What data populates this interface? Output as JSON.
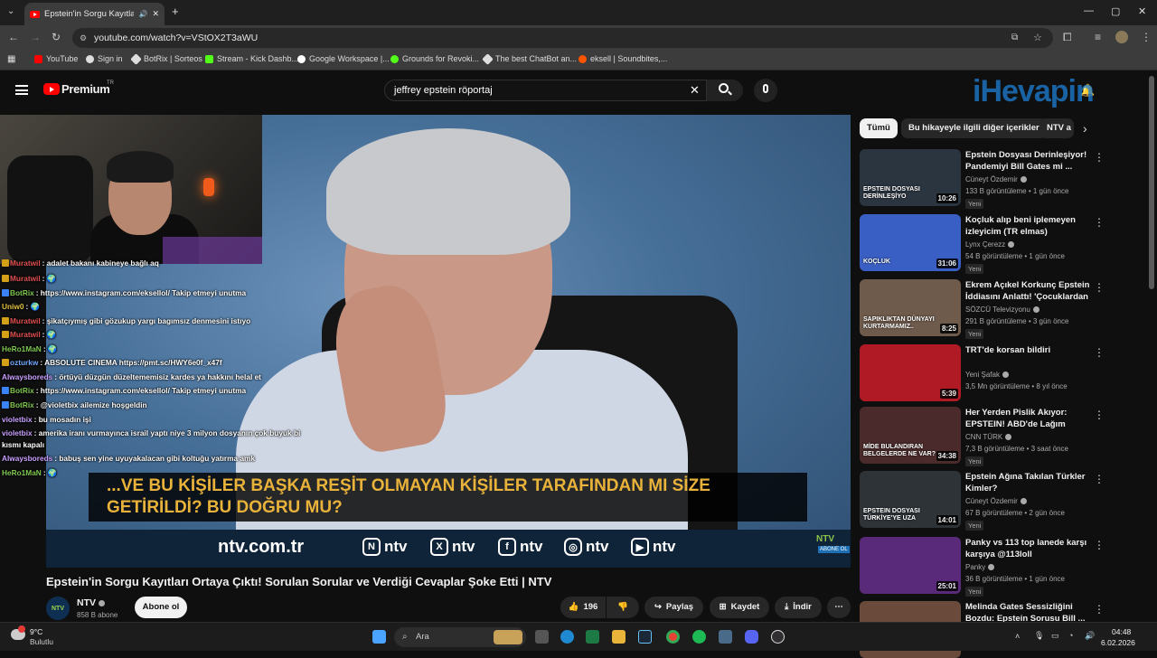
{
  "browser": {
    "tab_title": "Epstein'in Sorgu Kayıtları O",
    "url": "youtube.com/watch?v=VStOX2T3aWU",
    "bookmarks": [
      {
        "label": "YouTube",
        "color": "#ff0000"
      },
      {
        "label": "Sign in",
        "color": "#dddddd"
      },
      {
        "label": "BotRix | Sorteos",
        "color": "#dddddd"
      },
      {
        "label": "Stream - Kick Dashb...",
        "color": "#53fc18"
      },
      {
        "label": "Google Workspace |...",
        "color": "#dddddd"
      },
      {
        "label": "Grounds for Revoki...",
        "color": "#53fc18"
      },
      {
        "label": "The best ChatBot an...",
        "color": "#dddddd"
      },
      {
        "label": "eksell | Soundbites,...",
        "color": "#ff5500"
      }
    ]
  },
  "header": {
    "brand": "Premium",
    "region": "TR",
    "search_query": "jeffrey epstein röportaj",
    "watermark": "iHevapin"
  },
  "video": {
    "subtitle": "...VE BU KİŞİLER BAŞKA REŞİT OLMAYAN KİŞİLER TARAFINDAN MI SİZE GETİRİLDİ? BU DOĞRU MU?",
    "site": "ntv.com.tr",
    "socials": [
      "ntv",
      "ntv",
      "ntv",
      "ntv",
      "ntv"
    ],
    "corner_logo": "NTV",
    "corner_sub": "ABONE OL"
  },
  "chat": [
    {
      "user": "Muratwil",
      "text": ": adalet bakanı kabineye bağlı aq",
      "user_color": "#e05050",
      "icon_color": "#d4a017"
    },
    {
      "user": "Muratwil",
      "text": ": 🌍",
      "user_color": "#e05050",
      "icon_color": "#d4a017"
    },
    {
      "user": "BotRix",
      "text": ": https://www.instagram.com/eksellol/ Takip etmeyi unutma",
      "user_color": "#7ec850",
      "icon_color": "#3b82f6"
    },
    {
      "user": "Uniw0",
      "text": ": 🌍",
      "user_color": "#e0c040",
      "icon_color": ""
    },
    {
      "user": "Muratwil",
      "text": ": şikatçıymış gibi gözukup yargı bagımsız denmesini istıyo",
      "user_color": "#e05050",
      "icon_color": "#d4a017"
    },
    {
      "user": "Muratwil",
      "text": ": 🌍",
      "user_color": "#e05050",
      "icon_color": "#d4a017"
    },
    {
      "user": "HeRo1MaN",
      "text": ": 🌍",
      "user_color": "#7ec850",
      "icon_color": ""
    },
    {
      "user": "ozturkw",
      "text": ": ABSOLUTE CINEMA https://pmt.sc/HWY6e0f_x47f",
      "user_color": "#6fa8ff",
      "icon_color": "#d4a017"
    },
    {
      "user": "Alwaysboreds",
      "text": ": örtüyü düzgün düzeltememisiz kardes ya hakkını helal et",
      "user_color": "#c9a0ff",
      "icon_color": ""
    },
    {
      "user": "BotRix",
      "text": ": https://www.instagram.com/eksellol/ Takip etmeyi unutma",
      "user_color": "#7ec850",
      "icon_color": "#3b82f6"
    },
    {
      "user": "BotRix",
      "text": ": @violetbix ailemize hoşgeldin",
      "user_color": "#7ec850",
      "icon_color": "#3b82f6"
    },
    {
      "user": "violetbix",
      "text": ": bu mosadın işi",
      "user_color": "#c9a0ff",
      "icon_color": ""
    },
    {
      "user": "violetbix",
      "text": ": amerika iranı vurmayınca israil yaptı niye 3 milyon dosyanın çok buyuk bi",
      "user_color": "#c9a0ff",
      "icon_color": ""
    },
    {
      "user": "",
      "text": "kısmı kapalı",
      "user_color": "#ffffff",
      "icon_color": ""
    },
    {
      "user": "Alwaysboreds",
      "text": ": babuş sen yine uyuyakalacan gibi koltuğu yatırma amk",
      "user_color": "#c9a0ff",
      "icon_color": ""
    },
    {
      "user": "HeRo1MaN",
      "text": ": 🌍",
      "user_color": "#7ec850",
      "icon_color": ""
    }
  ],
  "watch": {
    "title": "Epstein'in Sorgu Kayıtları Ortaya Çıktı! Sorulan Sorular ve Verdiği Cevaplar Şoke Etti | NTV",
    "channel": "NTV",
    "channel_avatar": "NTV",
    "subscribers": "858 B abone",
    "subscribe": "Abone ol",
    "likes": "196",
    "share": "Paylaş",
    "save": "Kaydet",
    "download": "İndir"
  },
  "chips": [
    "Tümü",
    "Bu hikayeyle ilgili diğer içerikler",
    "NTV a"
  ],
  "recommendations": [
    {
      "title": "Epstein Dosyası Derinleşiyor! Pandemiyi Bill Gates mi ...",
      "channel": "Cüneyt Özdemir",
      "meta": "133 B görüntüleme • 1 gün önce",
      "badge": "Yeni",
      "duration": "10:26",
      "thumb": "#2b3540",
      "overlay": "EPSTEIN DOSYASI DERİNLEŞİYO"
    },
    {
      "title": "Koçluk alıp beni iplemeyen izleyicim (TR elmas)",
      "channel": "Lynx Çerezz",
      "meta": "54 B görüntüleme • 1 gün önce",
      "badge": "Yeni",
      "duration": "31:06",
      "thumb": "#3a5fc4",
      "overlay": "KOÇLUK"
    },
    {
      "title": "Ekrem Açıkel Korkunç Epstein İddiasını Anlattı! 'Çocuklardan ...",
      "channel": "SÖZCÜ Televizyonu",
      "meta": "291 B görüntüleme • 3 gün önce",
      "badge": "Yeni",
      "duration": "8:25",
      "thumb": "#6f5b4c",
      "overlay": "SAPIKLIKTAN DÜNYAYI KURTARMAMIZ.."
    },
    {
      "title": "TRT'de korsan bildiri",
      "channel": "Yeni Şafak",
      "meta": "3,5 Mn görüntüleme • 8 yıl önce",
      "badge": "",
      "duration": "5:39",
      "thumb": "#b01a25",
      "overlay": ""
    },
    {
      "title": "Her Yerden Pislik Akıyor: EPSTEIN! ABD'de Lağım Patla...",
      "channel": "CNN TÜRK",
      "meta": "7,3 B görüntüleme • 3 saat önce",
      "badge": "Yeni",
      "duration": "34:38",
      "thumb": "#4a2a2a",
      "overlay": "MİDE BULANDIRAN BELGELERDE NE VAR?"
    },
    {
      "title": "Epstein Ağına Takılan Türkler Kimler?",
      "channel": "Cüneyt Özdemir",
      "meta": "67 B görüntüleme • 2 gün önce",
      "badge": "Yeni",
      "duration": "14:01",
      "thumb": "#2e3338",
      "overlay": "EPSTEIN DOSYASI TÜRKİYE'YE UZA"
    },
    {
      "title": "Panky vs 113 top lanede karşı karşıya @113loll",
      "channel": "Panky",
      "meta": "36 B görüntüleme • 1 gün önce",
      "badge": "Yeni",
      "duration": "25:01",
      "thumb": "#5a2a7a",
      "overlay": ""
    },
    {
      "title": "Melinda Gates Sessizliğini Bozdu: Epstein Sorusu Bill ...",
      "channel": "",
      "meta": "",
      "badge": "",
      "duration": "",
      "thumb": "#6a4a3a",
      "overlay": ""
    }
  ],
  "taskbar": {
    "weather_temp": "9°C",
    "weather_desc": "Bulutlu",
    "search": "Ara",
    "time": "04:48",
    "date": "6.02.2026"
  },
  "colors": {
    "accent": "#ff0000",
    "subtitle": "#e9b23a",
    "background": "#0f0f0f"
  }
}
